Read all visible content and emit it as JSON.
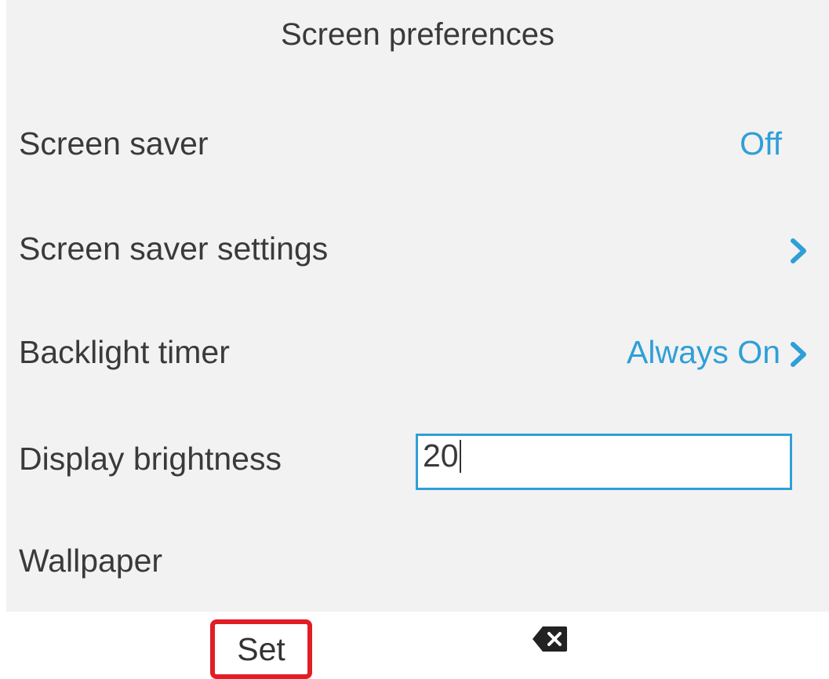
{
  "header": {
    "title": "Screen preferences"
  },
  "settings": {
    "screen_saver": {
      "label": "Screen saver",
      "value": "Off"
    },
    "screen_saver_settings": {
      "label": "Screen saver settings"
    },
    "backlight_timer": {
      "label": "Backlight timer",
      "value": "Always On"
    },
    "display_brightness": {
      "label": "Display brightness",
      "value": "20"
    },
    "wallpaper": {
      "label": "Wallpaper"
    }
  },
  "softkeys": {
    "set_label": "Set",
    "backspace_icon": "backspace-icon"
  },
  "colors": {
    "accent": "#2f9fd8",
    "highlight": "#e21d25",
    "background": "#f2f2f2",
    "text": "#3a3a3a"
  }
}
